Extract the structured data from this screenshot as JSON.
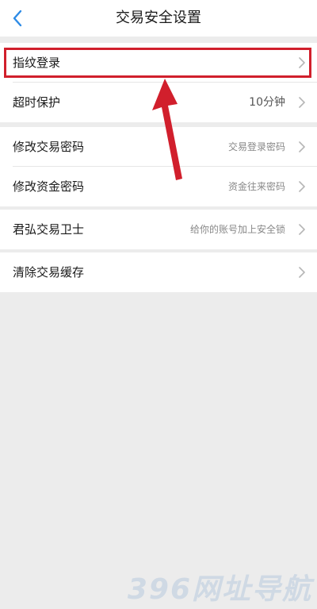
{
  "header": {
    "title": "交易安全设置",
    "back_icon": "chevron-left-icon",
    "accent_color": "#2d8be6"
  },
  "groups": [
    {
      "rows": [
        {
          "label": "指纹登录",
          "value": ""
        },
        {
          "label": "超时保护",
          "value": "10分钟"
        }
      ]
    },
    {
      "rows": [
        {
          "label": "修改交易密码",
          "value": "交易登录密码"
        },
        {
          "label": "修改资金密码",
          "value": "资金往来密码"
        }
      ]
    },
    {
      "rows": [
        {
          "label": "君弘交易卫士",
          "value": "给你的账号加上安全锁"
        }
      ]
    },
    {
      "rows": [
        {
          "label": "清除交易缓存",
          "value": ""
        }
      ]
    }
  ],
  "annotation": {
    "highlight_color": "#d11f2c"
  },
  "watermark": {
    "text": "396网址导航"
  }
}
